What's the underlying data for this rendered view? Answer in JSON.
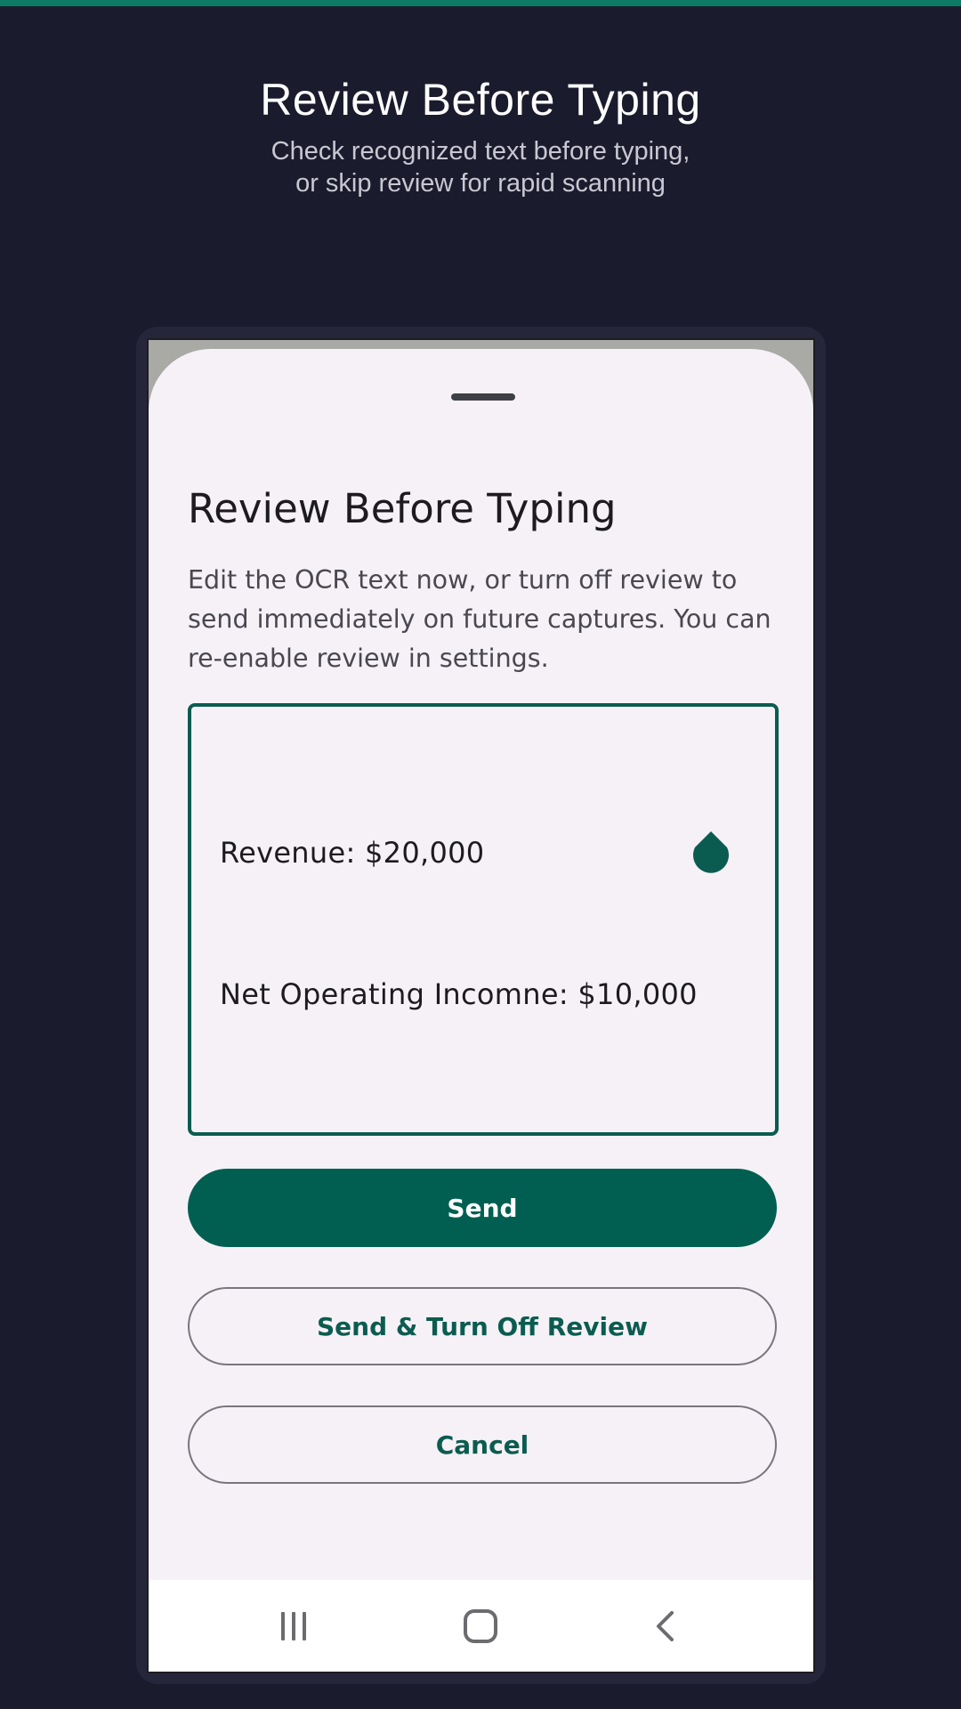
{
  "header": {
    "title": "Review Before Typing",
    "subtitle_lines": [
      "Check recognized text before typing,",
      "or skip review for rapid scanning"
    ]
  },
  "sheet": {
    "title": "Review Before Typing",
    "description": "Edit the OCR text now, or turn off review to send immediately on future captures. You can re-enable review in settings.",
    "ocr_lines": [
      "Revenue: $20,000",
      "Net Operating Incomne: $10,000"
    ],
    "buttons": {
      "send": "Send",
      "send_turn_off": "Send & Turn Off Review",
      "cancel": "Cancel"
    }
  },
  "nav_bar": {
    "icons": [
      "recents-icon",
      "home-icon",
      "back-icon"
    ]
  },
  "colors": {
    "background": "#1b1b2e",
    "accent": "#005f50",
    "sheet": "#f6f1f7",
    "top_bar": "#0d7a66"
  }
}
